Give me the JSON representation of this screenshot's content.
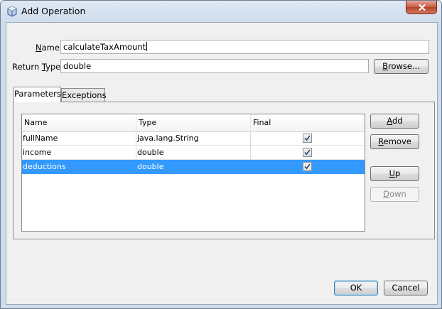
{
  "window": {
    "title": "Add Operation",
    "close_symbol": "×"
  },
  "form": {
    "name_label": "Name:",
    "name_value": "calculateTaxAmount",
    "return_type_label": "Return Type:",
    "return_type_value": "double",
    "browse_label": "Browse..."
  },
  "tabs": [
    {
      "label": "Parameters",
      "active": true
    },
    {
      "label": "Exceptions",
      "active": false
    }
  ],
  "parameters_table": {
    "columns": [
      "Name",
      "Type",
      "Final"
    ],
    "rows": [
      {
        "name": "fullName",
        "type": "java.lang.String",
        "final": true,
        "selected": false
      },
      {
        "name": "income",
        "type": "double",
        "final": true,
        "selected": false
      },
      {
        "name": "deductions",
        "type": "double",
        "final": true,
        "selected": true
      }
    ]
  },
  "side_buttons": {
    "add": "Add",
    "remove": "Remove",
    "up": "Up",
    "down": "Down",
    "down_enabled": false
  },
  "footer": {
    "ok": "OK",
    "cancel": "Cancel"
  },
  "colors": {
    "selection": "#3399ff",
    "close_button": "#c85a45"
  },
  "icons": {
    "app": "java-bean-cube-icon",
    "close": "close-icon",
    "checkbox": "checkmark-icon"
  }
}
